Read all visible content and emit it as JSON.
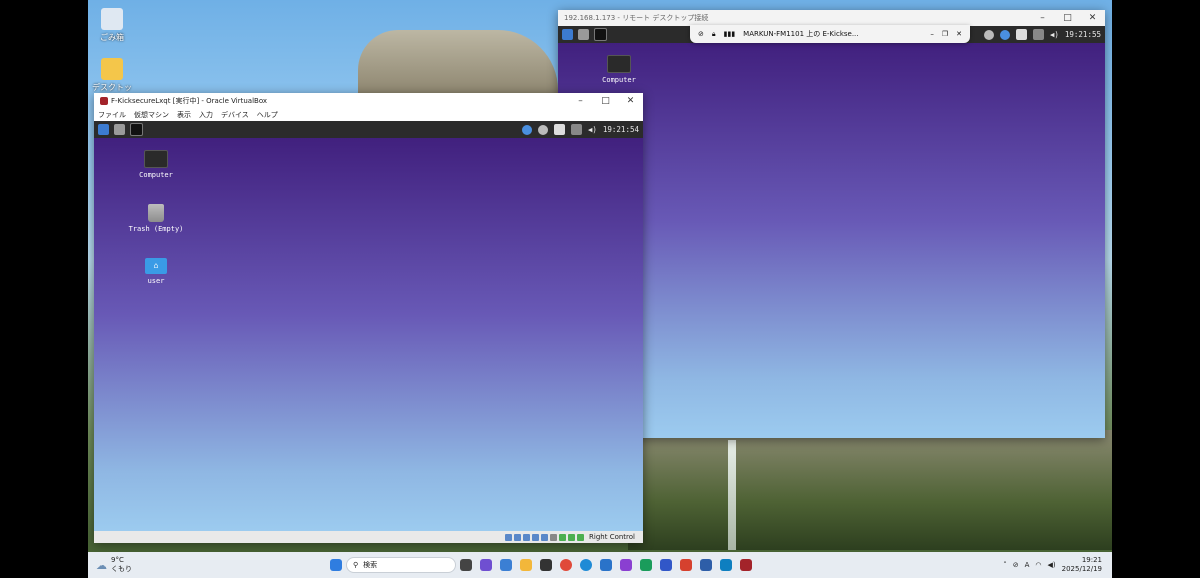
{
  "host_desktop": {
    "icons": [
      {
        "label": "ごみ箱",
        "icon": "recycle-bin-icon"
      },
      {
        "label": "デスクトップ",
        "icon": "folder-shortcut-icon"
      }
    ]
  },
  "rdp_window": {
    "title": "192.168.1.173 - リモート デスクトップ接続",
    "connection_bar": {
      "label": "MARKUN-FM1101 上の E-Kickse..."
    },
    "clock": "19:21:55",
    "desktop_icons": [
      {
        "label": "Computer",
        "icon": "computer-icon"
      }
    ]
  },
  "vbox_window": {
    "title": "F-KicksecureLxqt [実行中] - Oracle VirtualBox",
    "menu": [
      "ファイル",
      "仮想マシン",
      "表示",
      "入力",
      "デバイス",
      "ヘルプ"
    ],
    "clock": "19:21:54",
    "desktop_icons": [
      {
        "label": "Computer",
        "icon": "computer-icon"
      },
      {
        "label": "Trash (Empty)",
        "icon": "trash-icon"
      },
      {
        "label": "user",
        "icon": "home-folder-icon"
      }
    ],
    "status_right": "Right Control"
  },
  "taskbar": {
    "weather_temp": "9°C",
    "weather_desc": "くもり",
    "search_placeholder": "検索",
    "time": "19:21",
    "date": "2025/12/19",
    "ime": "A"
  },
  "colors": {
    "vm_desktop_top": "#41207e",
    "vm_desktop_bottom": "#9ccbef",
    "vm_toolbar": "#2b2b2b",
    "taskbar": "#e7ecf2"
  }
}
